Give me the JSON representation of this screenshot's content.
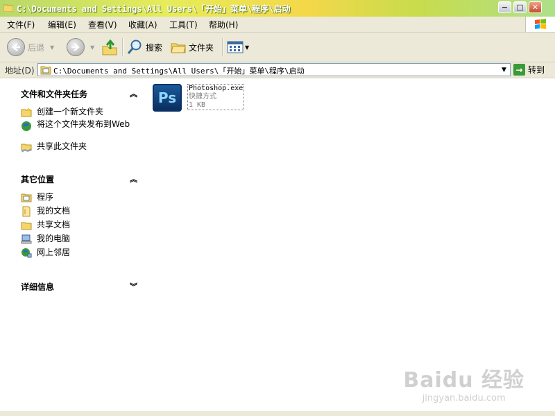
{
  "window": {
    "title": "C:\\Documents and Settings\\All Users\\「开始」菜单\\程序\\启动",
    "buttons": {
      "minimize": "−",
      "maximize": "□",
      "close": "✕"
    }
  },
  "menu": [
    "文件(F)",
    "编辑(E)",
    "查看(V)",
    "收藏(A)",
    "工具(T)",
    "帮助(H)"
  ],
  "toolbar": {
    "back_label": "后退",
    "search_label": "搜索",
    "folders_label": "文件夹"
  },
  "address": {
    "label": "地址(D)",
    "value": "C:\\Documents and Settings\\All Users\\「开始」菜单\\程序\\启动",
    "go_label": "转到"
  },
  "tasks": {
    "file_tasks": {
      "title": "文件和文件夹任务",
      "items": [
        "创建一个新文件夹",
        "将这个文件夹发布到Web",
        "共享此文件夹"
      ]
    },
    "other_places": {
      "title": "其它位置",
      "items": [
        "程序",
        "我的文档",
        "共享文档",
        "我的电脑",
        "网上邻居"
      ]
    },
    "details": {
      "title": "详细信息"
    }
  },
  "files": [
    {
      "name": "Photoshop.exe",
      "type": "快捷方式",
      "size": "1 KB",
      "icon_text": "Ps"
    }
  ],
  "watermark": {
    "main": "Baidu 经验",
    "sub": "jingyan.baidu.com"
  },
  "colors": {
    "ps_icon": "#0a2e5e",
    "ps_text": "#8ed6ff",
    "toolbar_bg": "#ece9d8"
  }
}
